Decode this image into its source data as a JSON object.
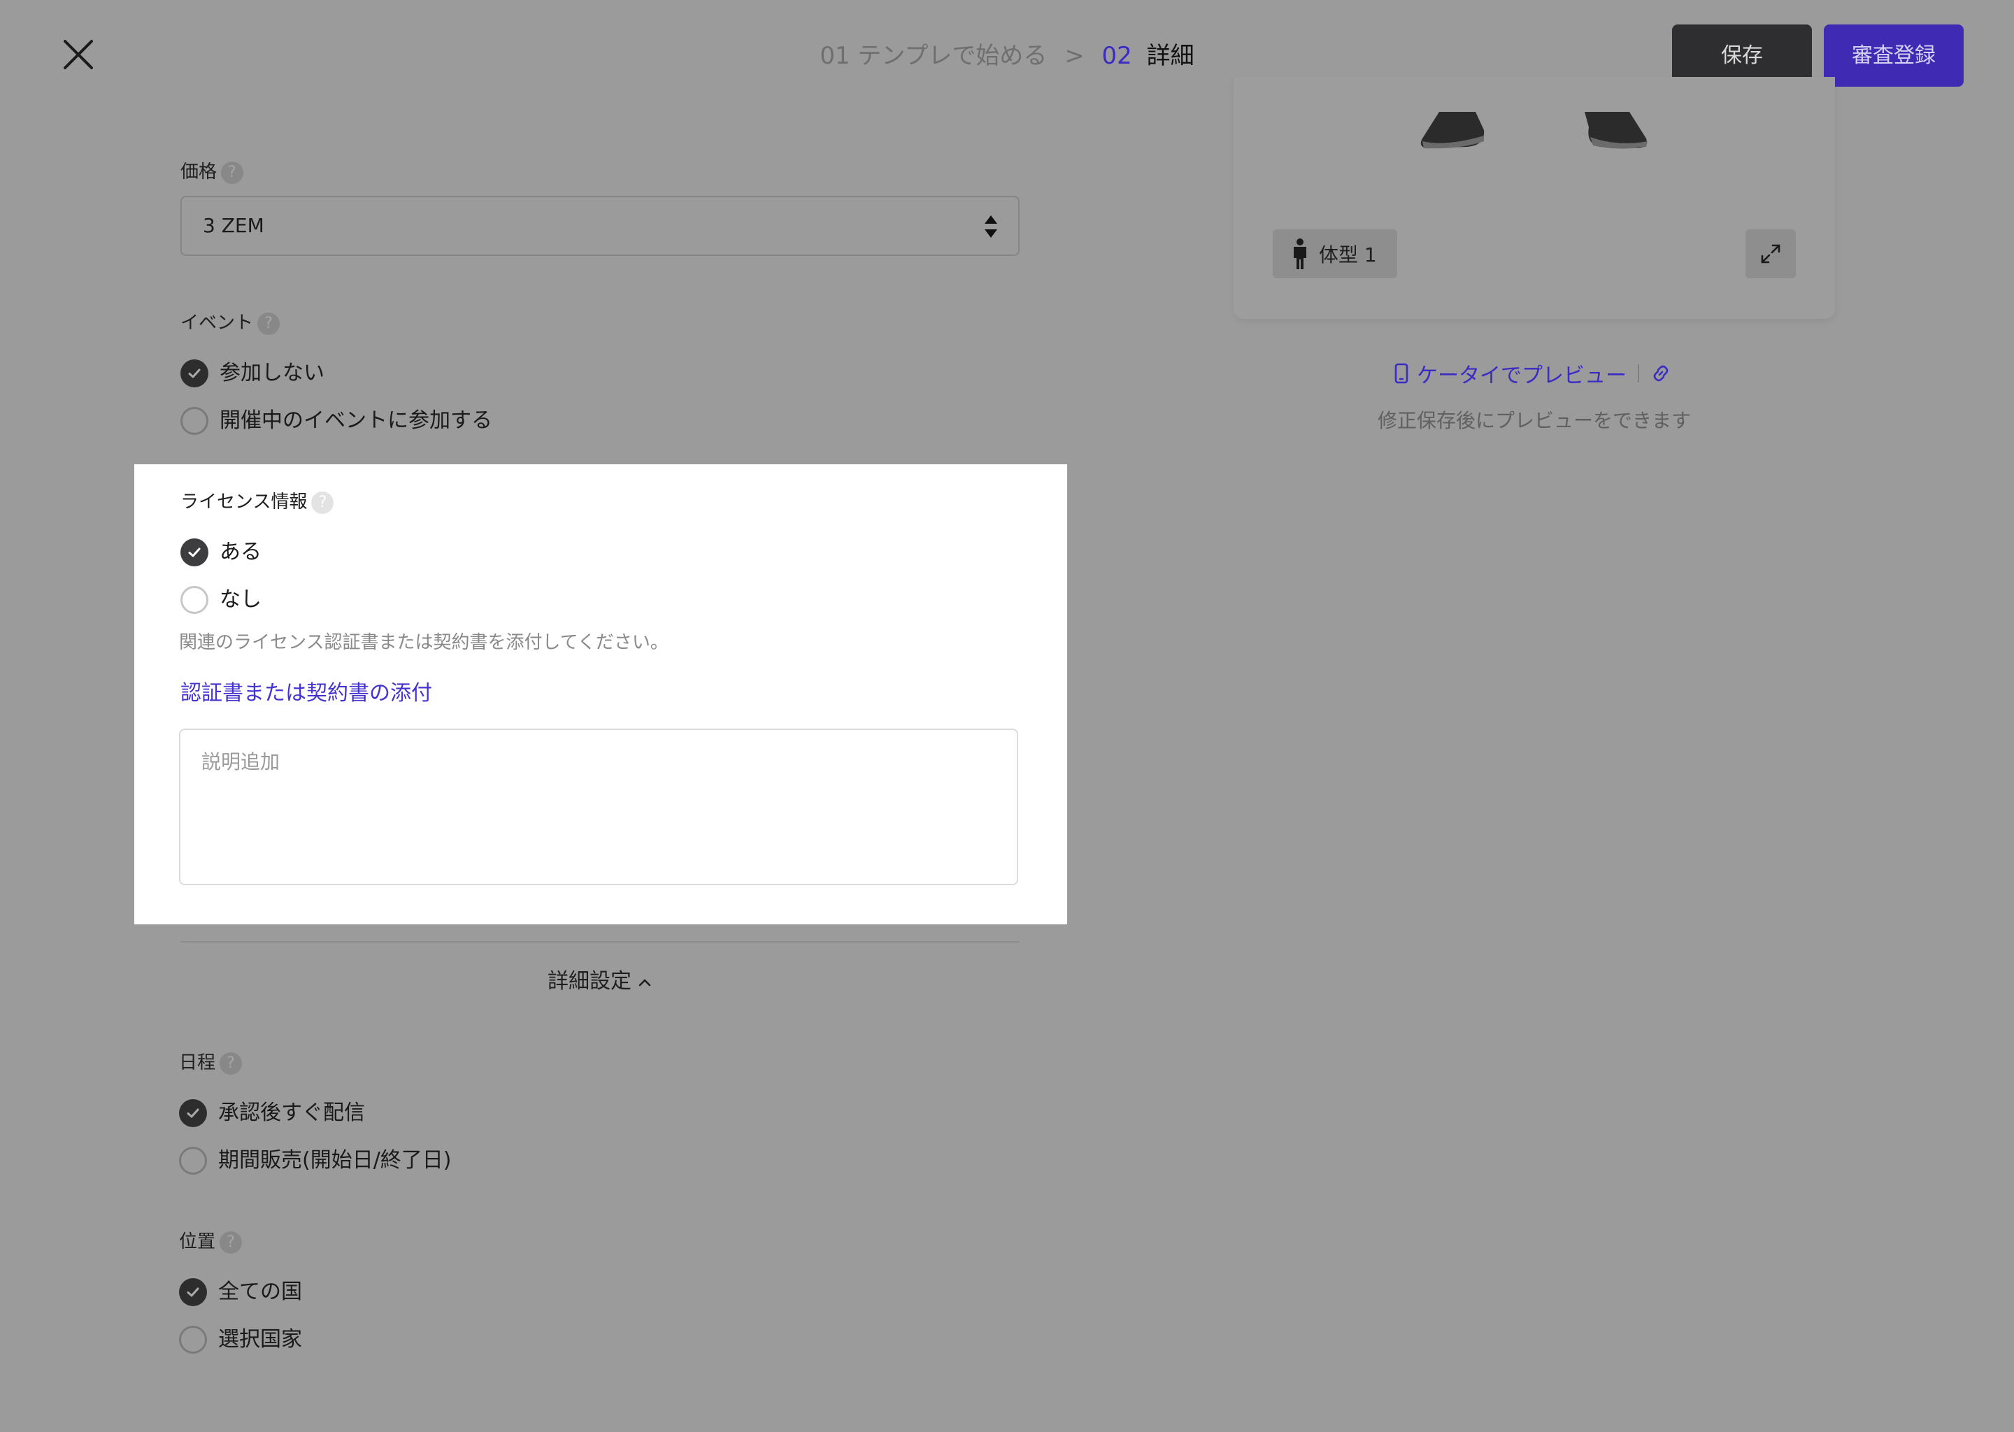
{
  "header": {
    "breadcrumb": {
      "step1": "01 テンプレで始める",
      "separator": ">",
      "step2_number": "02",
      "step2_label": "詳細"
    },
    "save_label": "保存",
    "submit_label": "審査登録"
  },
  "form": {
    "price": {
      "label": "価格",
      "value": "3 ZEM"
    },
    "event": {
      "label": "イベント",
      "options": [
        {
          "label": "参加しない",
          "selected": true
        },
        {
          "label": "開催中のイベントに参加する",
          "selected": false
        }
      ]
    },
    "license": {
      "label": "ライセンス情報",
      "options": [
        {
          "label": "ある",
          "selected": true
        },
        {
          "label": "なし",
          "selected": false
        }
      ],
      "hint": "関連のライセンス認証書または契約書を添付してください。",
      "attach_link": "認証書または契約書の添付",
      "description_placeholder": "説明追加"
    },
    "advanced_toggle": "詳細設定",
    "schedule": {
      "label": "日程",
      "options": [
        {
          "label": "承認後すぐ配信",
          "selected": true
        },
        {
          "label": "期間販売(開始日/終了日)",
          "selected": false
        }
      ]
    },
    "location": {
      "label": "位置",
      "options": [
        {
          "label": "全ての国",
          "selected": true
        },
        {
          "label": "選択国家",
          "selected": false
        }
      ]
    },
    "help_glyph": "?"
  },
  "preview": {
    "body_type": "体型 1",
    "mobile_preview": "ケータイでプレビュー",
    "note": "修正保存後にプレビューをできます"
  },
  "colors": {
    "overlay_background": "#9b9b9b",
    "accent": "#3f2bb3",
    "link": "#4433cf",
    "save_button": "#2e2e30",
    "panel": "#ffffff"
  }
}
